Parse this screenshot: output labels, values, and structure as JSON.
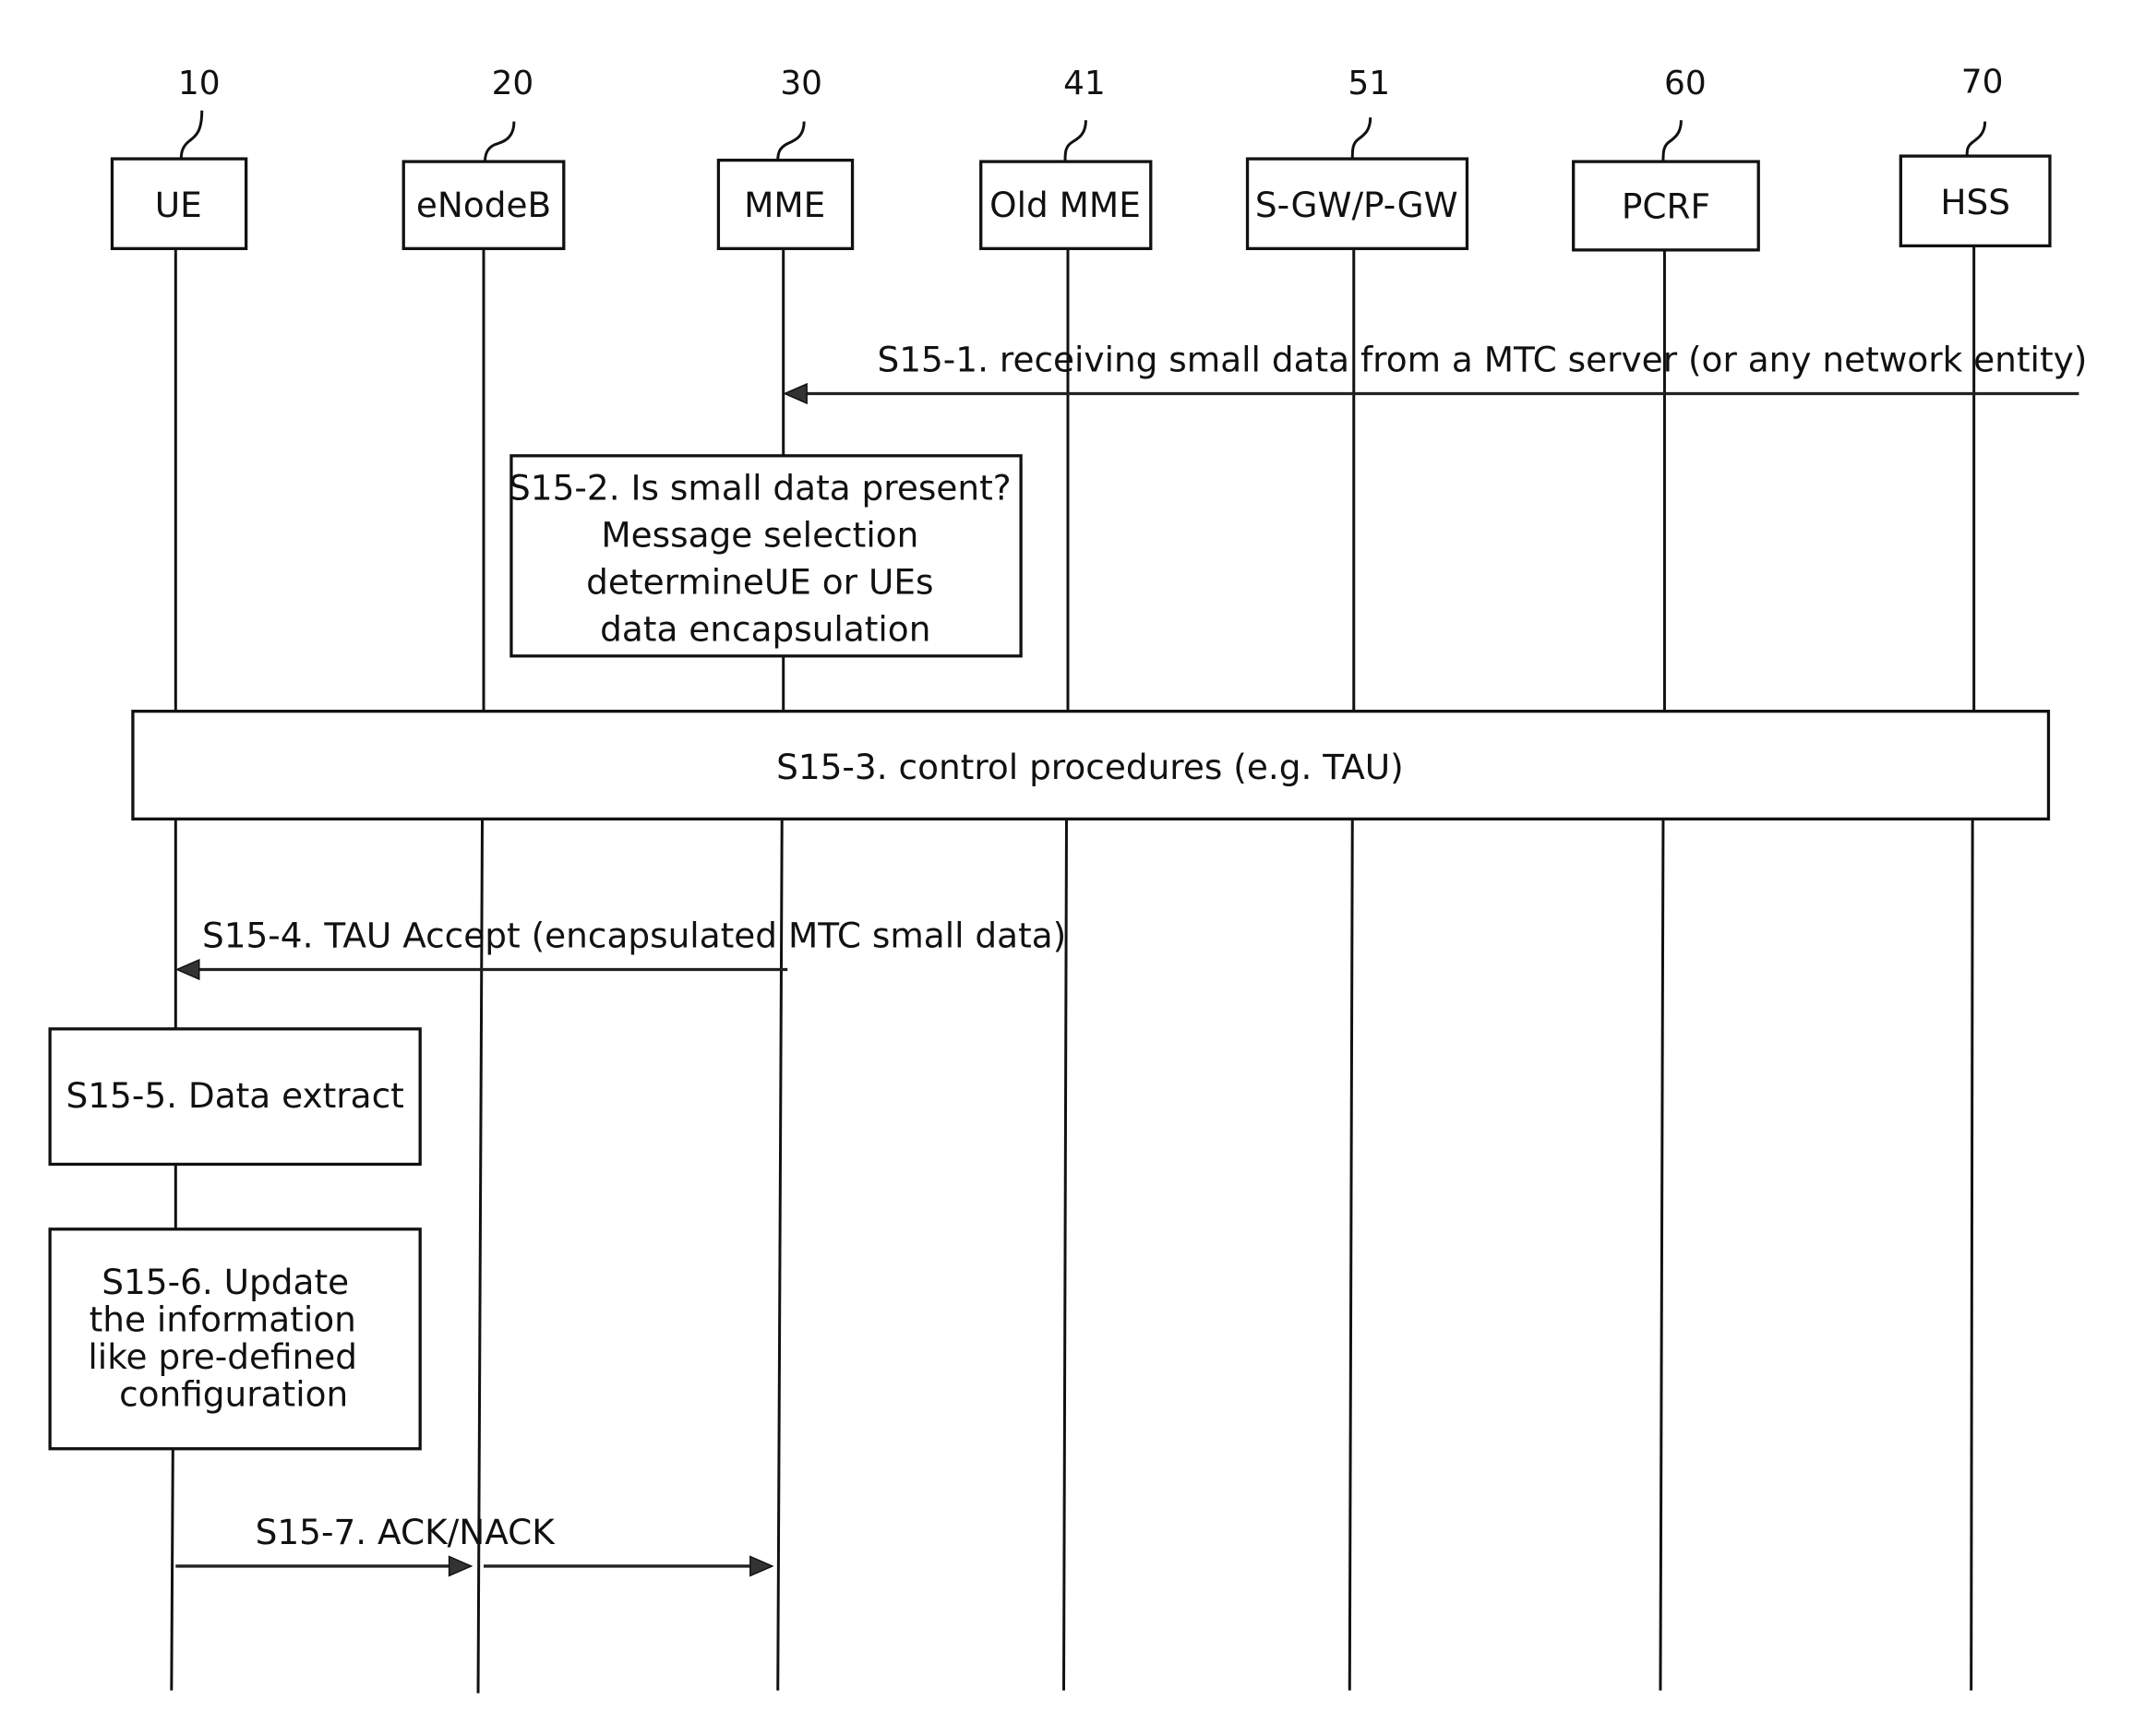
{
  "diagram": {
    "type": "sequence-diagram",
    "entities": [
      {
        "id": "ue",
        "ref": "10",
        "label": "UE"
      },
      {
        "id": "enodeb",
        "ref": "20",
        "label": "eNodeB"
      },
      {
        "id": "mme",
        "ref": "30",
        "label": "MME"
      },
      {
        "id": "old-mme",
        "ref": "41",
        "label": "Old MME"
      },
      {
        "id": "sgw-pgw",
        "ref": "51",
        "label": "S-GW/P-GW"
      },
      {
        "id": "pcrf",
        "ref": "60",
        "label": "PCRF"
      },
      {
        "id": "hss",
        "ref": "70",
        "label": "HSS"
      }
    ],
    "steps": {
      "s1": {
        "label": "S15-1. receiving small data from a MTC server (or any network entity)",
        "from": "external",
        "to": "mme"
      },
      "s2": {
        "lines": [
          "S15-2. Is small data present?",
          "Message selection",
          "determineUE or UEs",
          "data encapsulation"
        ],
        "at": "mme"
      },
      "s3": {
        "label": "S15-3. control procedures (e.g. TAU)",
        "span": "all"
      },
      "s4": {
        "label": "S15-4. TAU Accept (encapsulated MTC small data)",
        "from": "mme",
        "to": "ue"
      },
      "s5": {
        "label": "S15-5. Data extract",
        "at": "ue"
      },
      "s6": {
        "lines": [
          "S15-6. Update",
          "the information",
          "like pre-defined",
          "configuration"
        ],
        "at": "ue"
      },
      "s7": {
        "label": "S15-7. ACK/NACK",
        "from": "ue",
        "via": "enodeb",
        "to": "mme"
      }
    }
  }
}
